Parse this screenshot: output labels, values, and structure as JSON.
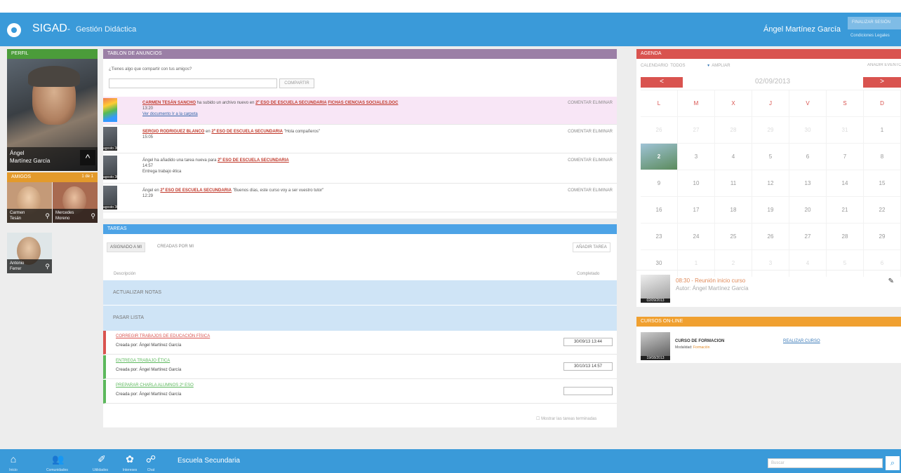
{
  "header": {
    "app_name": "SIGAD",
    "separator": "-",
    "app_subtitle": "Gestión Didáctica",
    "user_name": "Ángel Martínez García",
    "logout_label": "FINALIZAR SESIÓN",
    "legal_label": "Condiciones Legales"
  },
  "profile": {
    "header": "PERFIL",
    "first_name": "Ángel",
    "last_name": "Martínez García",
    "chevron_glyph": "^"
  },
  "friends": {
    "header": "AMIGOS",
    "count": "1 de 1",
    "items": [
      {
        "first": "Carmen",
        "last": "Tesán"
      },
      {
        "first": "Mercedes",
        "last": "Moreno"
      },
      {
        "first": "Antonio",
        "last": "Ferrer"
      }
    ]
  },
  "board": {
    "header": "TABLON DE ANUNCIOS",
    "prompt": "¿Tienes algo que compartir con tus amigos?",
    "share_label": "COMPARTIR",
    "posts": [
      {
        "author": "CARMEN TESÁN SANCHO",
        "text": " ha subido un archivo nuevo en ",
        "group": "2º ESO DE ESCUELA SECUNDARIA",
        "extra": "FICHAS CIENCIAS SOCIALES.DOC",
        "time": "13:20",
        "sub": "Ver documento  Ir a la carpeta",
        "date": "",
        "actions": "COMENTAR  ELIMINAR"
      },
      {
        "author": "SERGIO RODRIGUEZ BLANCO",
        "text": " en ",
        "group": "2º ESO DE ESCUELA SECUNDARIA",
        "extra": "\"Hola compañeros\"",
        "time": "15:05",
        "sub": "",
        "date": "agosto 30",
        "actions": "COMENTAR  ELIMINAR"
      },
      {
        "author": "",
        "text": "Ángel ha añadido una tarea nueva para ",
        "group": "2º ESO DE ESCUELA SECUNDARIA",
        "extra": "",
        "time": "14:57",
        "sub": "Entrega trabajo ética",
        "date": "agosto 30",
        "actions": "COMENTAR  ELIMINAR"
      },
      {
        "author": "",
        "text": "Ángel en ",
        "group": "2º ESO DE ESCUELA SECUNDARIA",
        "extra": "\"Buenos días, este curso voy a ser vuestro tutor\"",
        "time": "12:29",
        "sub": "",
        "date": "agosto 30",
        "actions": "COMENTAR  ELIMINAR"
      }
    ]
  },
  "tasks": {
    "header": "TAREAS",
    "tab_assigned": "ASIGNADO A MI",
    "tab_created": "CREADAS POR MI",
    "add_label": "AÑADIR TAREA",
    "col_desc": "Descripción",
    "col_done": "Completado",
    "groups": [
      "ACTUALIZAR NOTAS",
      "PASAR LISTA"
    ],
    "items": [
      {
        "title": "CORREGIR TRABAJOS DE EDUCACIÓN FÍSICA",
        "by": "Creada por: Ángel Martínez García",
        "date": "30/09/13 13:44",
        "color": "#d9534f"
      },
      {
        "title": "ENTREGA TRABAJO ÉTICA",
        "by": "Creada por: Ángel Martínez García",
        "date": "30/10/13 14:57",
        "color": "#5cb85c"
      },
      {
        "title": "PREPARAR CHARLA ALUMNOS 2º ESO",
        "by": "Creada por: Ángel Martínez García",
        "date": "",
        "color": "#5cb85c"
      }
    ],
    "show_done": "Mostrar las tareas terminadas"
  },
  "agenda": {
    "header": "AGENDA",
    "calendar_label": "CALENDARIO",
    "filter": "TODOS",
    "expand": "AMPLIAR",
    "add_event": "AÑADIR EVENTO",
    "month": "02/09/2013",
    "prev": "<",
    "next": ">",
    "weekdays": [
      "L",
      "M",
      "X",
      "J",
      "V",
      "S",
      "D"
    ],
    "weeks": [
      [
        "26",
        "27",
        "28",
        "29",
        "30",
        "31",
        "1"
      ],
      [
        "2",
        "3",
        "4",
        "5",
        "6",
        "7",
        "8"
      ],
      [
        "9",
        "10",
        "11",
        "12",
        "13",
        "14",
        "15"
      ],
      [
        "16",
        "17",
        "18",
        "19",
        "20",
        "21",
        "22"
      ],
      [
        "23",
        "24",
        "25",
        "26",
        "27",
        "28",
        "29"
      ],
      [
        "30",
        "1",
        "2",
        "3",
        "4",
        "5",
        "6"
      ]
    ],
    "event_title": "08:30 - Reunión inicio curso",
    "event_author": "Autor: Ángel Martínez García",
    "event_date": "02/09/2013"
  },
  "courses": {
    "header": "CURSOS ON-LINE",
    "name": "CURSO DE FORMACION",
    "mode_label": "Modalidad:",
    "mode_value": "Formación",
    "action": "REALIZAR CURSO",
    "date": "19/08/2013"
  },
  "footer": {
    "items": [
      "Inicio",
      "Comunidades",
      "Utilidades",
      "Intereses",
      "Chat"
    ],
    "school": "Escuela Secundaria",
    "search_placeholder": "Buscar"
  },
  "colors": {
    "primary": "#3a9ad9",
    "board": "#9b7fa6",
    "tasks": "#4da3e6",
    "agenda": "#d9534f",
    "courses": "#f0a030",
    "profile": "#4b9c3a"
  }
}
